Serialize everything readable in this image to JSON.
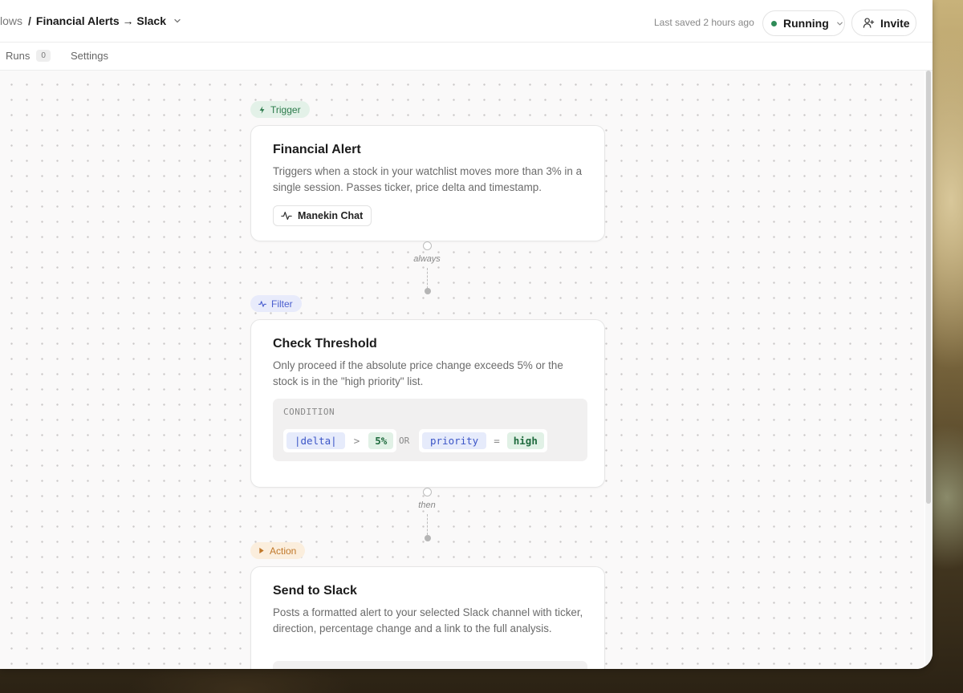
{
  "breadcrumb": {
    "parent": "lows",
    "separator": "/",
    "current": "Financial Alerts → Slack"
  },
  "header": {
    "saved_text": "Last saved 2 hours ago",
    "status_label": "Running",
    "status_color": "#2e8b57",
    "invite_label": "Invite"
  },
  "tabs": [
    {
      "label": "Runs",
      "badge": "0"
    },
    {
      "label": "Settings"
    }
  ],
  "nodes": {
    "trigger": {
      "tag": "Trigger",
      "title": "Financial Alert",
      "description": "Triggers when a stock in your watchlist moves more than 3% in a single session. Passes ticker, price delta and timestamp.",
      "chip_label": "Manekin Chat",
      "chip_icon": "activity-icon",
      "color": "#2b7a4b"
    },
    "filter": {
      "tag": "Filter",
      "title": "Check Threshold",
      "description": "Only proceed if the absolute price change exceeds 5% or the stock is in the \"high priority\" list.",
      "condition_label": "CONDITION",
      "condition": {
        "left": {
          "var": "|delta|",
          "op": ">",
          "value": "5%"
        },
        "joiner": "OR",
        "right": {
          "var": "priority",
          "op": "=",
          "value": "high"
        }
      },
      "color": "#4b5fcf"
    },
    "action": {
      "tag": "Action",
      "title": "Send to Slack",
      "description": "Posts a formatted alert to your selected Slack channel with ticker, direction, percentage change and a link to the full analysis.",
      "color": "#c0782a"
    }
  },
  "connectors": [
    {
      "label": "always"
    },
    {
      "label": "then"
    }
  ]
}
